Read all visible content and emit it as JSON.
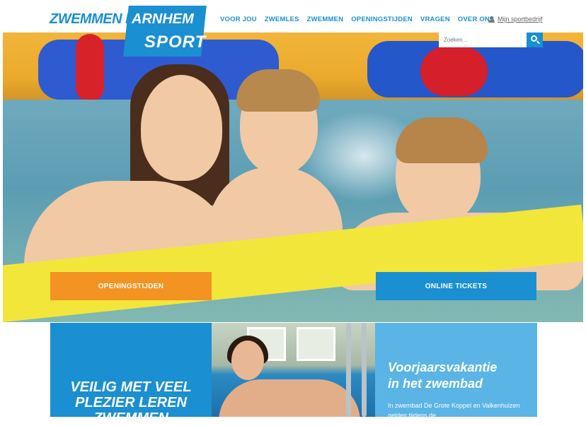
{
  "logo": {
    "line1": "ZWEMMEN IN",
    "line1b": "ARNHEM",
    "line2": "SPORT"
  },
  "nav": {
    "items": [
      "VOOR JOU",
      "ZWEMLES",
      "ZWEMMEN",
      "OPENINGSTIJDEN",
      "VRAGEN",
      "OVER ONS"
    ]
  },
  "account": {
    "label": "Mijn sportbedrijf"
  },
  "search": {
    "placeholder": "Zoeken..."
  },
  "hero": {
    "button_hours": "OPENINGSTIJDEN",
    "button_tickets": "ONLINE TICKETS"
  },
  "cards": {
    "left_title_1": "VEILIG MET VEEL",
    "left_title_2": "PLEZIER LEREN",
    "left_title_3": "ZWEMMEN",
    "right_title_1": "Voorjaarsvakantie",
    "right_title_2": "in het zwembad",
    "right_text": "In zwembad De Grote Koppel en Valkenhuizen gelden tijdens de"
  },
  "colors": {
    "brand_blue": "#1a8fd1",
    "orange": "#f29322",
    "light_blue": "#5ab4e5"
  }
}
